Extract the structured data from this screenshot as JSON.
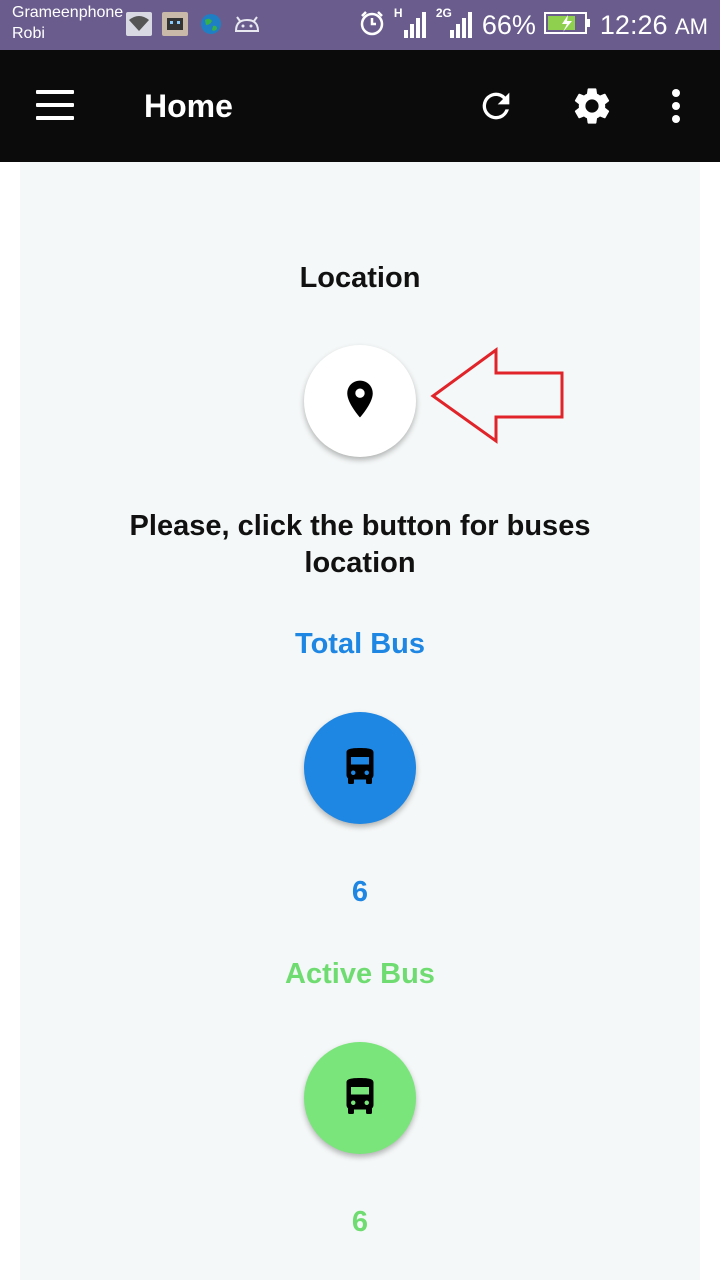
{
  "status_bar": {
    "carrier_1": "Grameenphone",
    "carrier_2": "Robi",
    "network_h": "H",
    "network_2g": "2G",
    "battery": "66%",
    "time": "12:26",
    "time_suffix": "AM"
  },
  "app_bar": {
    "title": "Home",
    "actions": [
      "menu-icon",
      "refresh-icon",
      "settings-icon",
      "more-vert-icon"
    ]
  },
  "location": {
    "title": "Location",
    "prompt": "Please, click the button for buses location",
    "button_icon": "location-pin-icon"
  },
  "total_bus": {
    "title": "Total Bus",
    "count": "6",
    "color": "#1e86e3",
    "icon": "bus-icon"
  },
  "active_bus": {
    "title": "Active Bus",
    "count": "6",
    "color": "#79e57a",
    "icon": "bus-icon"
  },
  "annotation": {
    "arrow_color": "#e0242a",
    "arrow_direction": "left"
  }
}
